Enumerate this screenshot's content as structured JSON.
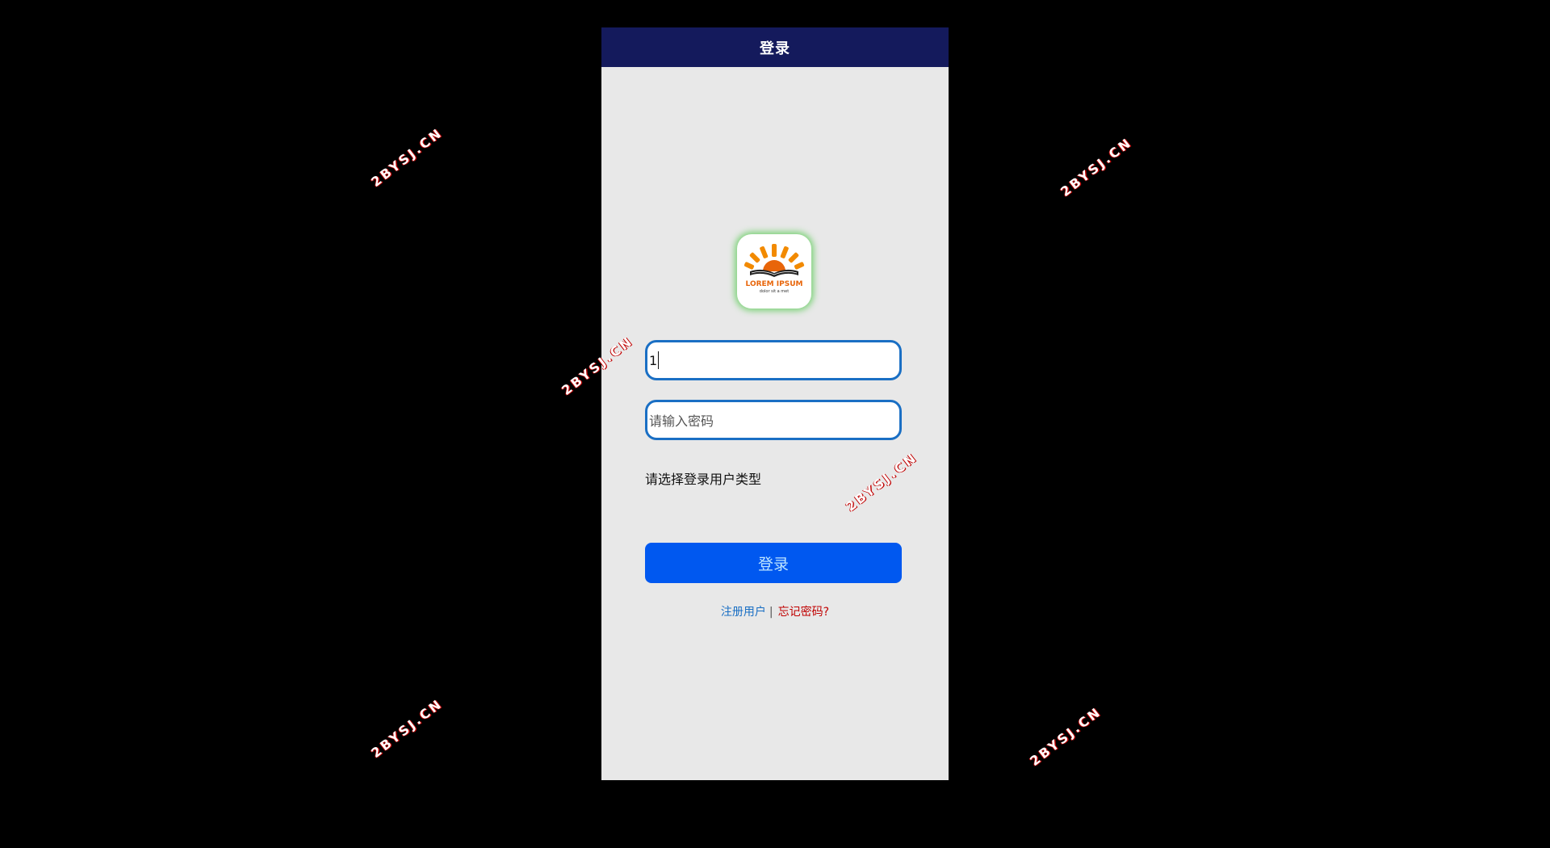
{
  "header": {
    "title": "登录"
  },
  "logo": {
    "name": "book-sun-logo",
    "text_main": "LOREM IPSUM",
    "text_sub": "dolor sit a met"
  },
  "form": {
    "username_value": "1",
    "password_placeholder": "请输入密码",
    "user_type_label": "请选择登录用户类型",
    "login_button": "登录"
  },
  "links": {
    "register": "注册用户",
    "separator": "|",
    "forgot": "忘记密码?"
  },
  "watermark": {
    "text": "2BYSJ.CN"
  },
  "colors": {
    "topbar": "#141a5c",
    "page_bg": "#e8e8e8",
    "input_border": "#1a6fc4",
    "button": "#0058f0",
    "forgot_link": "#c00000"
  }
}
